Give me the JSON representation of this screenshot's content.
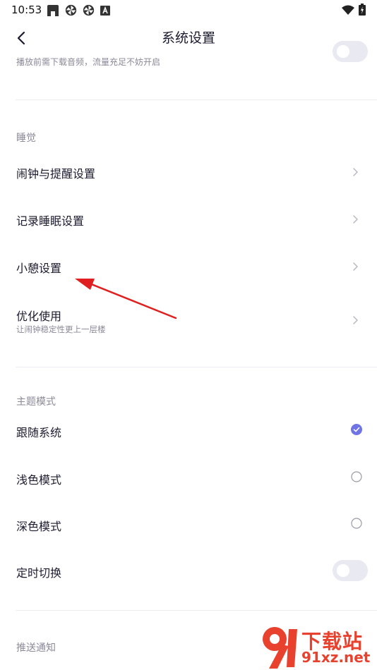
{
  "status_bar": {
    "time": "10:53",
    "left_icons": [
      "app-notification-icon",
      "pinwheel-icon",
      "pinwheel-icon",
      "a-badge-icon"
    ],
    "right_icons": [
      "wifi-icon",
      "battery-charging-icon"
    ]
  },
  "header": {
    "title": "系统设置",
    "back_icon": "chevron-left-icon"
  },
  "audio": {
    "partial_subtext": "播放前需下载音频，流量充足不妨开启",
    "toggle_on": false
  },
  "sleep": {
    "section_title": "睡觉",
    "items": [
      {
        "label": "闹钟与提醒设置",
        "subtext": ""
      },
      {
        "label": "记录睡眠设置",
        "subtext": ""
      },
      {
        "label": "小憩设置",
        "subtext": ""
      },
      {
        "label": "优化使用",
        "subtext": "让闹钟稳定性更上一层楼"
      }
    ]
  },
  "theme": {
    "section_title": "主题模式",
    "options": [
      {
        "label": "跟随系统",
        "selected": true
      },
      {
        "label": "浅色模式",
        "selected": false
      },
      {
        "label": "深色模式",
        "selected": false
      }
    ],
    "scheduled_switch_label": "定时切换",
    "scheduled_switch_on": false
  },
  "push": {
    "section_title": "推送通知"
  },
  "watermark": {
    "brand_top": "下载站",
    "brand_bottom": "91xz.net"
  },
  "colors": {
    "accent": "#6e74e6",
    "toggle_off": "#e9e9f2",
    "annotation_arrow": "#e02020",
    "watermark": "#e8422f"
  }
}
